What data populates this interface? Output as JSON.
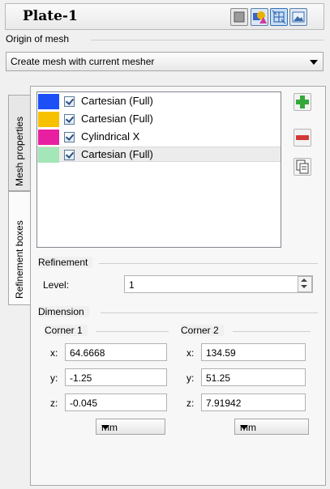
{
  "header": {
    "title": "Plate-1",
    "buttons": [
      "view-icon",
      "shapes-icon",
      "mesh-icon",
      "image-icon"
    ]
  },
  "origin": {
    "label": "Origin of mesh",
    "selected": "Create mesh with current mesher"
  },
  "tabs": [
    {
      "label": "Mesh properties",
      "active": false
    },
    {
      "label": "Refinement boxes",
      "active": true
    }
  ],
  "boxes": [
    {
      "color": "#1c4ff5",
      "checked": true,
      "label": "Cartesian (Full)"
    },
    {
      "color": "#f8c100",
      "checked": true,
      "label": "Cartesian (Full)"
    },
    {
      "color": "#e81fa0",
      "checked": true,
      "label": "Cylindrical X"
    },
    {
      "color": "#a3e6b7",
      "checked": true,
      "label": "Cartesian (Full)",
      "selected": true
    }
  ],
  "actions": {
    "add": "add-icon",
    "remove": "remove-icon",
    "copy": "copy-icon"
  },
  "refinement": {
    "section": "Refinement",
    "level_label": "Level:",
    "level_value": "1"
  },
  "dimension": {
    "section": "Dimension",
    "corner1": {
      "label": "Corner 1",
      "x_label": "x:",
      "x": "64.6668",
      "y_label": "y:",
      "y": "-1.25",
      "z_label": "z:",
      "z": "-0.045",
      "unit": "mm"
    },
    "corner2": {
      "label": "Corner 2",
      "x_label": "x:",
      "x": "134.59",
      "y_label": "y:",
      "y": "51.25",
      "z_label": "z:",
      "z": "7.91942",
      "unit": "mm"
    }
  }
}
